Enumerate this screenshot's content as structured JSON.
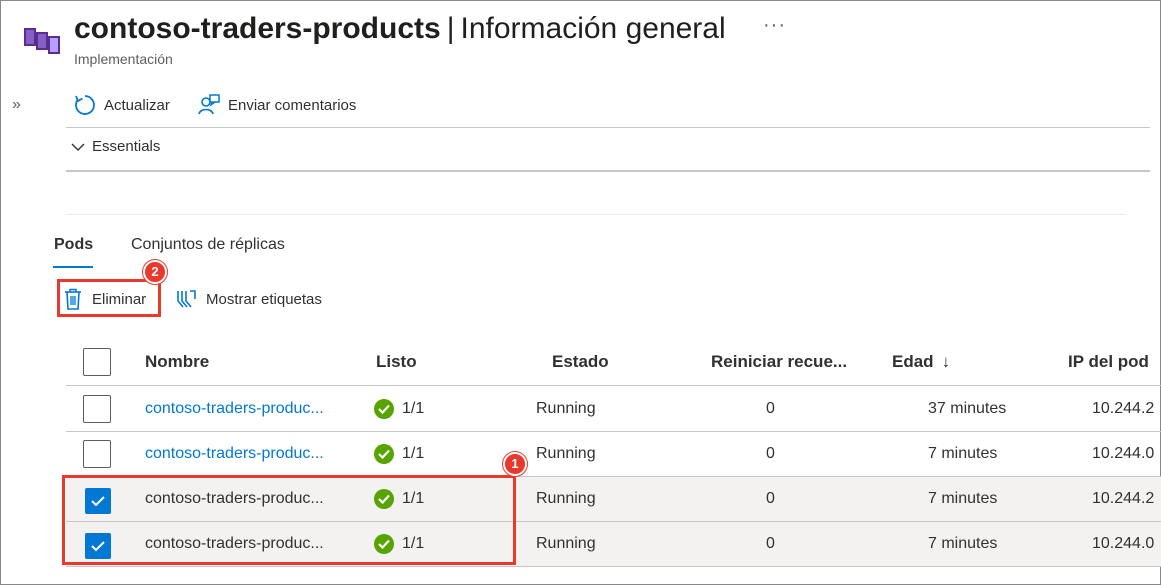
{
  "header": {
    "resource_name": "contoso-traders-products",
    "separator": "|",
    "page_name": "Información general",
    "subtitle": "Implementación",
    "more_label": "···",
    "icon": "deployment-icon"
  },
  "sidebar": {
    "expand_label": "»"
  },
  "toolbar": {
    "refresh_label": "Actualizar",
    "feedback_label": "Enviar comentarios"
  },
  "essentials": {
    "label": "Essentials"
  },
  "tabs": [
    {
      "label": "Pods",
      "active": true
    },
    {
      "label": "Conjuntos de réplicas",
      "active": false
    }
  ],
  "actions": {
    "delete_label": "Eliminar",
    "show_labels_label": "Mostrar etiquetas"
  },
  "annotations": {
    "badge_1": "1",
    "badge_2": "2"
  },
  "grid": {
    "columns": [
      "Nombre",
      "Listo",
      "Estado",
      "Reiniciar recue...",
      "Edad",
      "IP del pod"
    ],
    "sort_indicator": "↓",
    "rows": [
      {
        "name": "contoso-traders-produc...",
        "ready": "1/1",
        "state": "Running",
        "restarts": "0",
        "age": "37 minutes",
        "ip": "10.244.2",
        "selected": false
      },
      {
        "name": "contoso-traders-produc...",
        "ready": "1/1",
        "state": "Running",
        "restarts": "0",
        "age": "7 minutes",
        "ip": "10.244.0",
        "selected": false
      },
      {
        "name": "contoso-traders-produc...",
        "ready": "1/1",
        "state": "Running",
        "restarts": "0",
        "age": "7 minutes",
        "ip": "10.244.2",
        "selected": true
      },
      {
        "name": "contoso-traders-produc...",
        "ready": "1/1",
        "state": "Running",
        "restarts": "0",
        "age": "7 minutes",
        "ip": "10.244.0",
        "selected": true
      }
    ]
  },
  "colors": {
    "accent": "#0078d4",
    "highlight": "#e8392c",
    "success": "#57a300",
    "selected_row": "#f3f2f1"
  }
}
